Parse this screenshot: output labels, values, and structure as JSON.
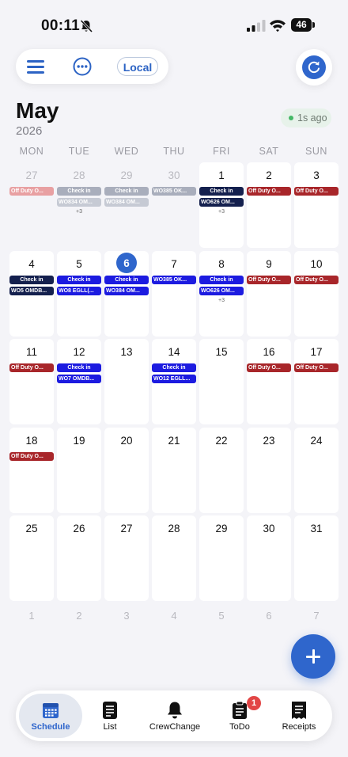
{
  "status_bar": {
    "time": "00:11",
    "battery": "46"
  },
  "toolbar": {
    "timezone_label": "Local"
  },
  "header": {
    "month": "May",
    "year": "2026",
    "sync_status": "1s ago"
  },
  "weekdays": [
    "MON",
    "TUE",
    "WED",
    "THU",
    "FRI",
    "SAT",
    "SUN"
  ],
  "weeks": [
    [
      {
        "day": "27",
        "in_month": false,
        "events": [
          {
            "text": "Off Duty O...",
            "kind": "dimred"
          }
        ]
      },
      {
        "day": "28",
        "in_month": false,
        "events": [
          {
            "text": "Check in",
            "kind": "dimgray"
          },
          {
            "text": "WO834 OM...",
            "kind": "dimgray2"
          }
        ],
        "more": "+3"
      },
      {
        "day": "29",
        "in_month": false,
        "events": [
          {
            "text": "Check in",
            "kind": "dimgray"
          },
          {
            "text": "WO384 OM...",
            "kind": "dimgray2"
          }
        ]
      },
      {
        "day": "30",
        "in_month": false,
        "events": [
          {
            "text": "WO385 OK...",
            "kind": "dimgray"
          }
        ]
      },
      {
        "day": "1",
        "in_month": true,
        "events": [
          {
            "text": "Check in",
            "kind": "navy"
          },
          {
            "text": "WO626 OM...",
            "kind": "navy"
          }
        ],
        "more": "+3"
      },
      {
        "day": "2",
        "in_month": true,
        "events": [
          {
            "text": "Off Duty O...",
            "kind": "red"
          }
        ]
      },
      {
        "day": "3",
        "in_month": true,
        "events": [
          {
            "text": "Off Duty O...",
            "kind": "red"
          }
        ]
      }
    ],
    [
      {
        "day": "4",
        "in_month": true,
        "events": [
          {
            "text": "Check in",
            "kind": "navy"
          },
          {
            "text": "WO5 OMDB...",
            "kind": "navy"
          }
        ]
      },
      {
        "day": "5",
        "in_month": true,
        "events": [
          {
            "text": "Check in",
            "kind": "blue"
          },
          {
            "text": "WO8 EGLL(...",
            "kind": "blue"
          }
        ]
      },
      {
        "day": "6",
        "in_month": true,
        "today": true,
        "events": [
          {
            "text": "Check in",
            "kind": "blue"
          },
          {
            "text": "WO384 OM...",
            "kind": "blue"
          }
        ]
      },
      {
        "day": "7",
        "in_month": true,
        "events": [
          {
            "text": "WO385 OK...",
            "kind": "blue"
          }
        ]
      },
      {
        "day": "8",
        "in_month": true,
        "events": [
          {
            "text": "Check in",
            "kind": "blue"
          },
          {
            "text": "WO626 OM...",
            "kind": "blue"
          }
        ],
        "more": "+3"
      },
      {
        "day": "9",
        "in_month": true,
        "events": [
          {
            "text": "Off Duty O...",
            "kind": "red"
          }
        ]
      },
      {
        "day": "10",
        "in_month": true,
        "events": [
          {
            "text": "Off Duty O...",
            "kind": "red"
          }
        ]
      }
    ],
    [
      {
        "day": "11",
        "in_month": true,
        "events": [
          {
            "text": "Off Duty O...",
            "kind": "red"
          }
        ]
      },
      {
        "day": "12",
        "in_month": true,
        "events": [
          {
            "text": "Check in",
            "kind": "blue"
          },
          {
            "text": "WO7 OMDB...",
            "kind": "blue"
          }
        ]
      },
      {
        "day": "13",
        "in_month": true,
        "events": []
      },
      {
        "day": "14",
        "in_month": true,
        "events": [
          {
            "text": "Check in",
            "kind": "blue"
          },
          {
            "text": "WO12 EGLL...",
            "kind": "blue"
          }
        ]
      },
      {
        "day": "15",
        "in_month": true,
        "events": []
      },
      {
        "day": "16",
        "in_month": true,
        "events": [
          {
            "text": "Off Duty O...",
            "kind": "red"
          }
        ]
      },
      {
        "day": "17",
        "in_month": true,
        "events": [
          {
            "text": "Off Duty O...",
            "kind": "red"
          }
        ]
      }
    ],
    [
      {
        "day": "18",
        "in_month": true,
        "events": [
          {
            "text": "Off Duty O...",
            "kind": "red"
          }
        ]
      },
      {
        "day": "19",
        "in_month": true,
        "events": []
      },
      {
        "day": "20",
        "in_month": true,
        "events": []
      },
      {
        "day": "21",
        "in_month": true,
        "events": []
      },
      {
        "day": "22",
        "in_month": true,
        "events": []
      },
      {
        "day": "23",
        "in_month": true,
        "events": []
      },
      {
        "day": "24",
        "in_month": true,
        "events": []
      }
    ],
    [
      {
        "day": "25",
        "in_month": true,
        "events": []
      },
      {
        "day": "26",
        "in_month": true,
        "events": []
      },
      {
        "day": "27",
        "in_month": true,
        "events": []
      },
      {
        "day": "28",
        "in_month": true,
        "events": []
      },
      {
        "day": "29",
        "in_month": true,
        "events": []
      },
      {
        "day": "30",
        "in_month": true,
        "events": []
      },
      {
        "day": "31",
        "in_month": true,
        "events": []
      }
    ]
  ],
  "next_month_days": [
    "1",
    "2",
    "3",
    "4",
    "5",
    "6",
    "7"
  ],
  "event_colors": {
    "red": "#a8262a",
    "navy": "#14204e",
    "blue": "#1c1be0",
    "dimred": "#e8a0a2",
    "dimgray": "#a9aebc",
    "dimgray2": "#c6cad4"
  },
  "accent_color": "#2f66cc",
  "icons": {
    "menu": "hamburger-icon",
    "more": "ellipsis-circle-icon",
    "refresh": "refresh-icon",
    "add": "plus-icon"
  },
  "tabs": [
    {
      "label": "Schedule",
      "icon": "calendar-grid-icon",
      "active": true
    },
    {
      "label": "List",
      "icon": "list-document-icon",
      "active": false
    },
    {
      "label": "CrewChange",
      "icon": "bell-icon",
      "active": false
    },
    {
      "label": "ToDo",
      "icon": "clipboard-icon",
      "active": false,
      "badge": "1"
    },
    {
      "label": "Receipts",
      "icon": "receipt-icon",
      "active": false
    }
  ]
}
